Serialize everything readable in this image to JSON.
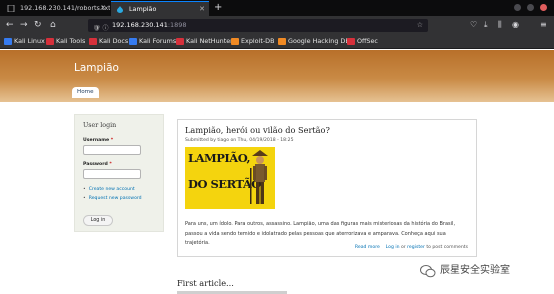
{
  "browser": {
    "tabs": [
      {
        "title": "192.168.230.141/roborts.txt",
        "active": false
      },
      {
        "title": "Lampião",
        "active": true
      }
    ],
    "new_tab": "+",
    "url_host": "192.168.230.141",
    "url_port": ":1898",
    "bookmarks": [
      {
        "label": "Kali Linux",
        "color": "#367bf0"
      },
      {
        "label": "Kali Tools",
        "color": "#d6303b"
      },
      {
        "label": "Kali Docs",
        "color": "#d6303b"
      },
      {
        "label": "Kali Forums",
        "color": "#367bf0"
      },
      {
        "label": "Kali NetHunter",
        "color": "#d6303b"
      },
      {
        "label": "Exploit-DB",
        "color": "#f08a24"
      },
      {
        "label": "Google Hacking DB",
        "color": "#f08a24"
      },
      {
        "label": "OffSec",
        "color": "#d6303b"
      }
    ]
  },
  "site": {
    "name": "Lampião",
    "nav_home": "Home"
  },
  "login": {
    "title": "User login",
    "username_label": "Username",
    "password_label": "Password",
    "required_mark": "*",
    "create_account": "Create new account",
    "request_password": "Request new password",
    "login_button": "Log in"
  },
  "article": {
    "title": "Lampião, herói ou vilão do Sertão?",
    "meta": "Submitted by tiago on Thu, 04/19/2018 - 18:25",
    "image_line1": "LAMPIÃO,",
    "image_line2": "DO SERTÃO",
    "body": "Para uns, um ídolo. Para outros, assassino. Lampião, uma das figuras mais misteriosas da história do Brasil, passou a vida sendo temido e idolatrado pelas pessoas que aterrorizava e amparava. Conheça aqui sua trajetória.",
    "read_more": "Read more",
    "login_link": "Log in",
    "or_text": " or ",
    "register_link": "register",
    "post_text": " to post comments"
  },
  "second_article": {
    "title": "First article..."
  },
  "watermark": {
    "text": "辰星安全实验室"
  }
}
